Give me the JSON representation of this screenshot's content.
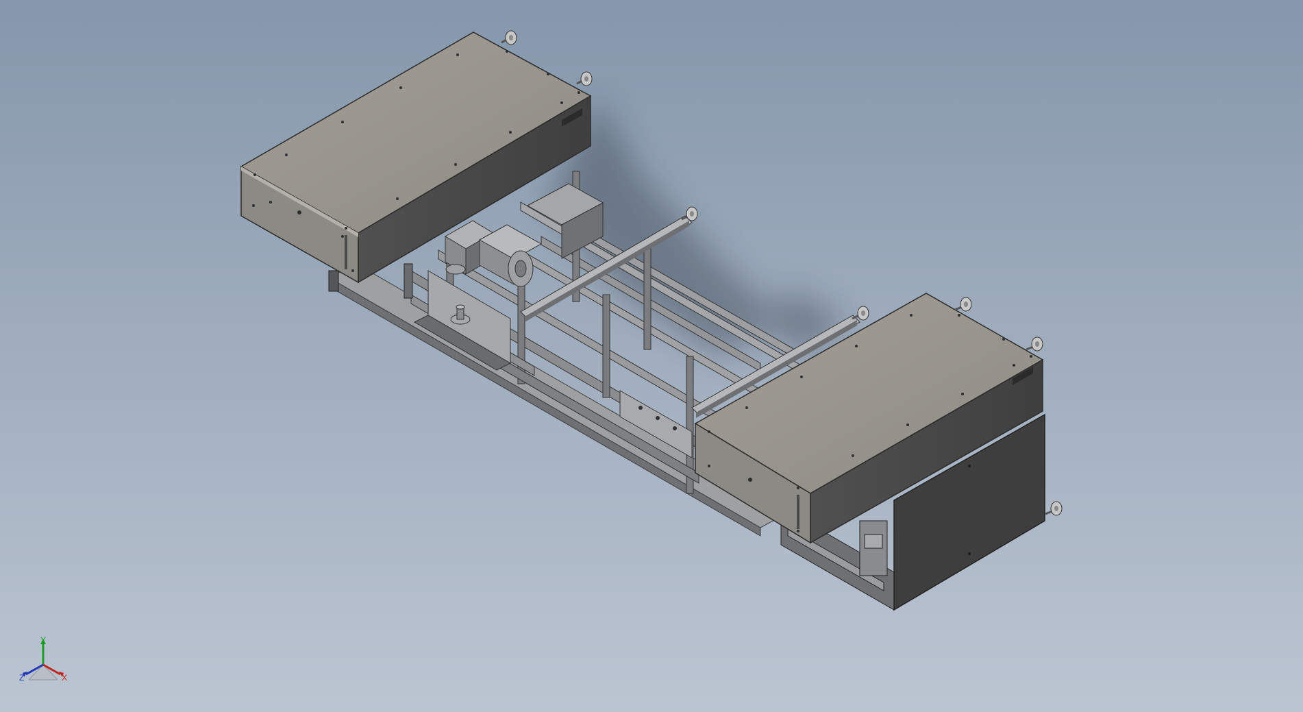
{
  "viewport": {
    "background_top": "#8597ab",
    "background_bottom": "#bcc5d2"
  },
  "model": {
    "description_icon": "cad-isometric-assembly",
    "colors": {
      "top_face": "#9b9890",
      "side_face": "#4b4b4b",
      "front_face": "#8c8a85",
      "frame": "#8e8f91",
      "frame_dark": "#5c5d60",
      "detail": "#2f3033"
    }
  },
  "triad": {
    "y_label": "Y",
    "x_label": "X",
    "z_label": "Z",
    "colors": {
      "y": "#1f9a2a",
      "x": "#c2261d",
      "z": "#2136b8"
    }
  }
}
